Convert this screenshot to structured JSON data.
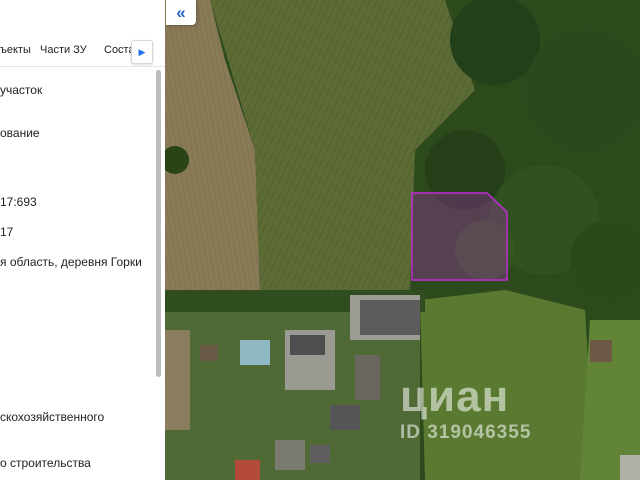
{
  "tabs": [
    "ъекты",
    "Части ЗУ",
    "Соста"
  ],
  "tab_next_icon": "chevron-right",
  "fields": [
    "участок",
    "ование",
    "17:693",
    "17",
    "я область, деревня Горки",
    "скохозяйственного",
    "о строительства"
  ],
  "map": {
    "collapse_icon": "double-chevron-left",
    "parcel_color": "#c02bd6",
    "watermark_brand": "циан",
    "watermark_id": "ID 319046355"
  }
}
